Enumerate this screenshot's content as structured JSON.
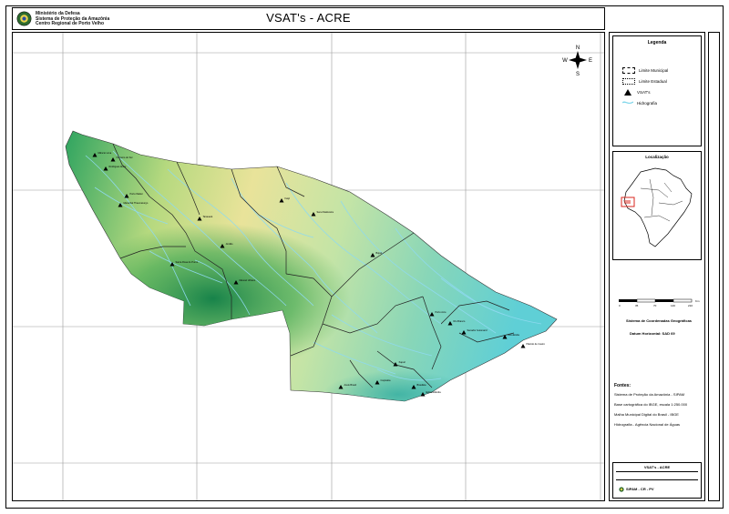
{
  "header": {
    "institution": [
      "Ministério da Defesa",
      "Sistema de Proteção da Amazônia",
      "Centro Regional de Porto Velho"
    ],
    "title": "VSAT's - ACRE"
  },
  "compass": {
    "n": "N",
    "s": "S",
    "e": "E",
    "w": "W"
  },
  "legend": {
    "title": "Legenda",
    "items": [
      {
        "label": "Limite Municipal",
        "kind": "dashed"
      },
      {
        "label": "Limite Estadual",
        "kind": "dotted"
      },
      {
        "label": "VSAT's",
        "kind": "marker"
      },
      {
        "label": "Hidrografia",
        "kind": "water",
        "color": "#7fd6ea"
      }
    ]
  },
  "location_map": {
    "title": "Localização"
  },
  "scale": {
    "ticks": [
      "0",
      "35",
      "70",
      "140",
      "210"
    ],
    "unit": "Km"
  },
  "projection": {
    "line1": "Sistema de Coordenadas Geográficas",
    "line2": "Datum Horizontal: SAD 69"
  },
  "notes": {
    "title": "Fontes:",
    "items": [
      "Sistema de Proteção da Amazônia - SIPAM",
      "Base cartográfica do IBGE, escala 1:250.000",
      "Malha Municipal Digital do Brasil - IBGE",
      "Hidrografia - Agência Nacional de Águas"
    ]
  },
  "credits": {
    "caption": "VSAT's - ACRE",
    "org": "SIPAM - CR - PV"
  },
  "colors": {
    "terrain_low": "#30b6a8",
    "terrain_mid": "#9fd592",
    "terrain_high": "#eee79a",
    "terrain_green": "#1f9b4f",
    "water": "#8fdaf0",
    "vsat": "#000000"
  },
  "vsat_sites": [
    {
      "label": "Mâncio Lima"
    },
    {
      "label": "Cruzeiro do Sul"
    },
    {
      "label": "Rodrigues Alves"
    },
    {
      "label": "Porto Walter"
    },
    {
      "label": "Marechal Thaumaturgo"
    },
    {
      "label": "Tarauacá"
    },
    {
      "label": "Jordão"
    },
    {
      "label": "Feijó"
    },
    {
      "label": "Santa Rosa do Purus"
    },
    {
      "label": "Manoel Urbano"
    },
    {
      "label": "Sena Madureira"
    },
    {
      "label": "Bujari"
    },
    {
      "label": "Porto Acre"
    },
    {
      "label": "Rio Branco"
    },
    {
      "label": "Senador Guiomard"
    },
    {
      "label": "Acrelândia"
    },
    {
      "label": "Plácido de Castro"
    },
    {
      "label": "Xapuri"
    },
    {
      "label": "Capixaba"
    },
    {
      "label": "Brasiléia"
    },
    {
      "label": "Epitaciolândia"
    },
    {
      "label": "Assis Brasil"
    }
  ]
}
